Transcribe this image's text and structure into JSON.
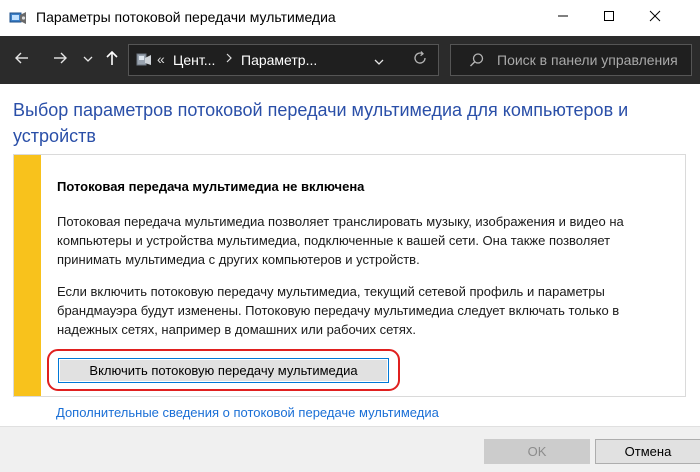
{
  "window": {
    "title": "Параметры потоковой передачи мультимедиа"
  },
  "address_bar": {
    "crumbs": [
      "Цент...",
      "Параметр..."
    ],
    "overflow_marker": "«"
  },
  "search": {
    "placeholder": "Поиск в панели управления"
  },
  "content": {
    "heading": "Выбор параметров потоковой передачи мультимедиа для компьютеров и устройств",
    "panel_title": "Потоковая передача мультимедиа не включена",
    "paragraph1": "Потоковая передача мультимедиа позволяет транслировать музыку, изображения и видео на компьютеры и устройства мультимедиа, подключенные к вашей сети. Она также позволяет принимать мультимедиа с других компьютеров и устройств.",
    "paragraph2": "Если включить потоковую передачу мультимедиа, текущий сетевой профиль и параметры брандмауэра будут изменены. Потоковую передачу мультимедиа следует включать только в надежных сетях, например в домашних или рабочих сетях.",
    "enable_button": "Включить потоковую передачу мультимедиа",
    "more_link": "Дополнительные сведения о потоковой передаче мультимедиа"
  },
  "footer": {
    "ok_label": "OK",
    "cancel_label": "Отмена"
  },
  "colors": {
    "accent_stripe": "#f8c21c",
    "heading_blue": "#2a4fa8",
    "link_blue": "#1a6fd6",
    "highlight_red": "#e0201f",
    "navbar_dark": "#2b2b2b"
  },
  "icons": [
    "control-panel-icon",
    "minimize-icon",
    "maximize-icon",
    "close-icon",
    "back-arrow-icon",
    "forward-arrow-icon",
    "chevron-down-icon",
    "up-arrow-icon",
    "location-icon",
    "refresh-icon",
    "search-icon"
  ]
}
